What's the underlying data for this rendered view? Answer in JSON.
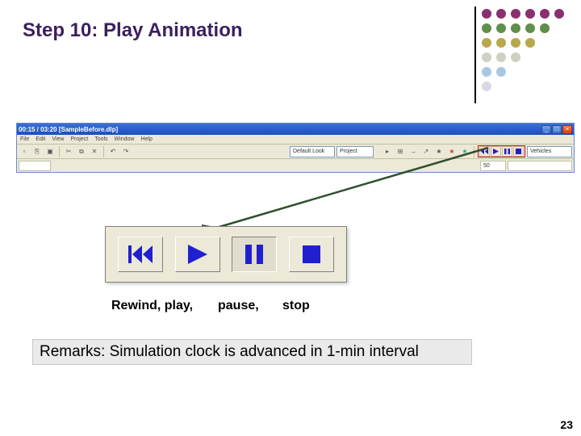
{
  "slide": {
    "title": "Step 10: Play Animation",
    "number": "23"
  },
  "dots": {
    "colors": [
      [
        "#8a2f6f",
        "#8a2f6f",
        "#8a2f6f",
        "#8a2f6f",
        "#8a2f6f",
        "#8a2f6f"
      ],
      [
        "#5f8f4a",
        "#5f8f4a",
        "#5f8f4a",
        "#5f8f4a",
        "#5f8f4a",
        ""
      ],
      [
        "#b8a84c",
        "#b8a84c",
        "#b8a84c",
        "#b8a84c",
        "",
        ""
      ],
      [
        "#d0d0c0",
        "#d0d0c0",
        "#d0d0c0",
        "",
        "",
        ""
      ],
      [
        "#a8c8e0",
        "#a8c8e0",
        "",
        "",
        "",
        ""
      ],
      [
        "#d8d8e8",
        "",
        "",
        "",
        "",
        ""
      ]
    ]
  },
  "app": {
    "titlebar": "00:15 / 03:20  [SampleBefore.dlp]",
    "win_min": "_",
    "win_max": "□",
    "win_close": "×",
    "menu": [
      "File",
      "Edit",
      "View",
      "Project",
      "Tools",
      "Window",
      "Help"
    ],
    "combo_label": "Default Look",
    "combo_proj": "Project",
    "vehicles_label": "Vehicles",
    "formula_val": "50",
    "play_icons": {
      "rewind": "rewind-icon",
      "play": "play-icon",
      "pause": "pause-icon",
      "stop": "stop-icon"
    }
  },
  "caption": {
    "rewind_play": "Rewind, play,",
    "pause": "pause,",
    "stop": "stop"
  },
  "remark": "Remarks: Simulation clock is advanced in 1-min interval"
}
